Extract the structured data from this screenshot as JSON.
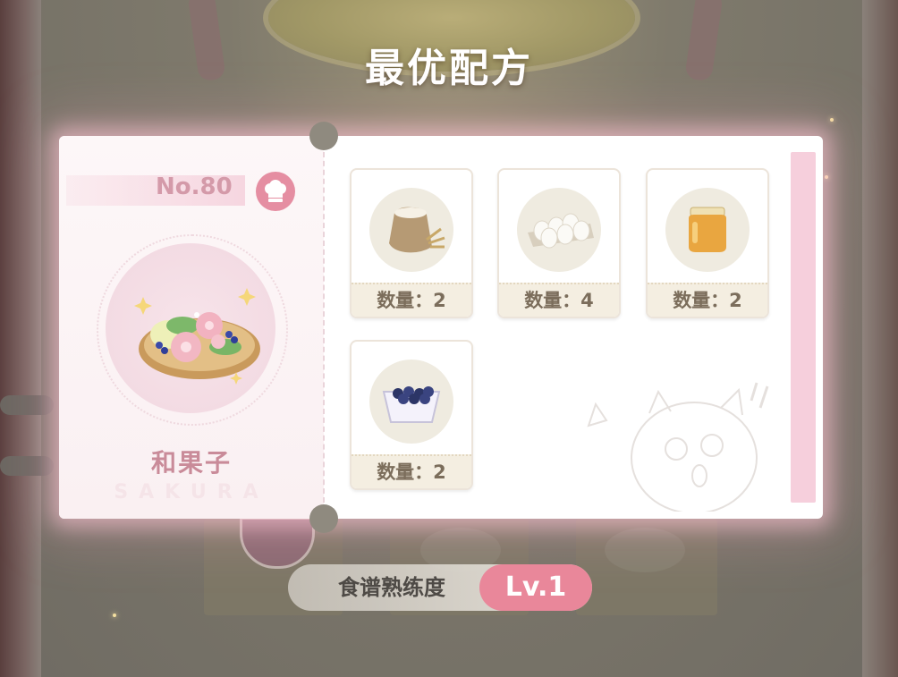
{
  "title": "最优配方",
  "recipe": {
    "number": "No.80",
    "name": "和果子",
    "subtitle": "SAKURA"
  },
  "ingredients": [
    {
      "icon": "flour-sack-icon",
      "quantity_label": "数量：2"
    },
    {
      "icon": "eggs-icon",
      "quantity_label": "数量：4"
    },
    {
      "icon": "honey-jar-icon",
      "quantity_label": "数量：2"
    },
    {
      "icon": "blueberries-icon",
      "quantity_label": "数量：2"
    }
  ],
  "proficiency": {
    "label": "食谱熟练度",
    "level": "Lv.1"
  },
  "colors": {
    "accent_pink": "#e9879a",
    "card_glow": "#ffc8d7",
    "stripe_pink": "#f6cfdc"
  }
}
